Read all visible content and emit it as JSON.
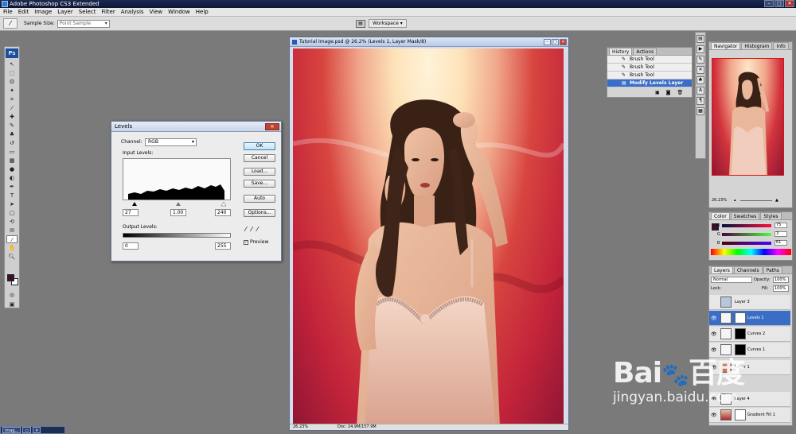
{
  "app": {
    "title": "Adobe Photoshop CS3 Extended"
  },
  "menu": [
    "File",
    "Edit",
    "Image",
    "Layer",
    "Select",
    "Filter",
    "Analysis",
    "View",
    "Window",
    "Help"
  ],
  "options_bar": {
    "sample_size_label": "Sample Size:",
    "sample_size_value": "Point Sample",
    "workspace_label": "Workspace ▾"
  },
  "toolbox": {
    "logo": "Ps"
  },
  "document": {
    "title": "Tutorial Image.psd @ 26.2% (Levels 1, Layer Mask/8)",
    "zoom": "26.23%",
    "doc_info": "Doc: 24.9M/157.9M"
  },
  "levels": {
    "title": "Levels",
    "channel_label": "Channel:",
    "channel_value": "RGB",
    "input_label": "Input Levels:",
    "input_values": [
      "27",
      "1.00",
      "240"
    ],
    "output_label": "Output Levels:",
    "output_values": [
      "0",
      "255"
    ],
    "buttons": [
      "OK",
      "Cancel",
      "Load...",
      "Save...",
      "Auto",
      "Options..."
    ],
    "preview_label": "Preview",
    "preview_checked": true
  },
  "history": {
    "tabs": [
      "History",
      "Actions"
    ],
    "items": [
      "Brush Tool",
      "Brush Tool",
      "Brush Tool",
      "Modify Levels Layer"
    ],
    "selected_index": 3
  },
  "navigator": {
    "tabs": [
      "Navigator",
      "Histogram",
      "Info"
    ],
    "zoom": "26.23%"
  },
  "color": {
    "tabs": [
      "Color",
      "Swatches",
      "Styles"
    ],
    "channels": [
      {
        "label": "R",
        "value": "75"
      },
      {
        "label": "G",
        "value": "3"
      },
      {
        "label": "B",
        "value": "61"
      }
    ],
    "foreground": "#3a0f2e"
  },
  "layers": {
    "tabs": [
      "Layers",
      "Channels",
      "Paths"
    ],
    "blend_mode": "Normal",
    "opacity_label": "Opacity:",
    "opacity_value": "100%",
    "lock_label": "Lock:",
    "fill_label": "Fill:",
    "fill_value": "100%",
    "items": [
      {
        "name": "Layer 3",
        "mask": "none",
        "selected": false
      },
      {
        "name": "Levels 1",
        "mask": "white",
        "selected": true
      },
      {
        "name": "Curves 2",
        "mask": "black",
        "selected": false
      },
      {
        "name": "Curves 1",
        "mask": "black",
        "selected": false
      },
      {
        "name": "Layer 1",
        "mask": "none",
        "selected": false
      },
      {
        "name": "Layer 4",
        "mask": "none",
        "selected": false
      },
      {
        "name": "Gradient Fill 1",
        "mask": "white",
        "selected": false
      }
    ]
  },
  "watermark": {
    "brand": "Bai度",
    "url": "jingyan.baidu.com"
  },
  "taskbar": {
    "item": "Imag..."
  }
}
